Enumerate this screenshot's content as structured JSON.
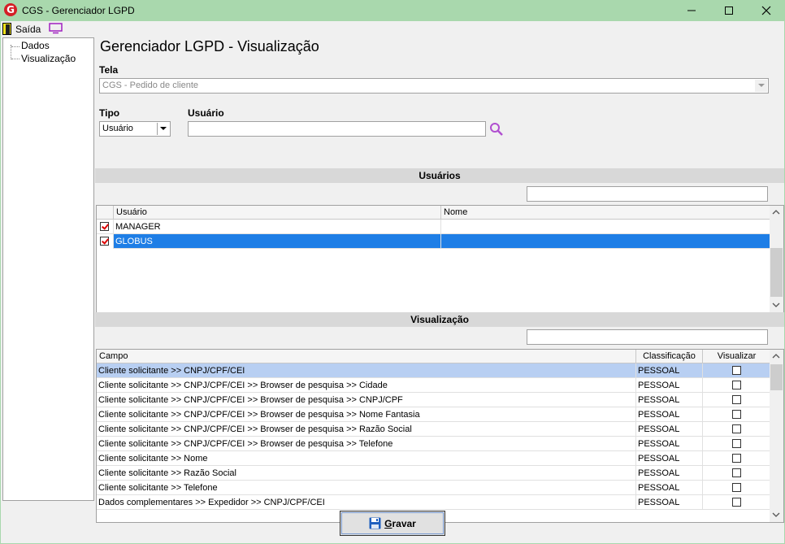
{
  "window": {
    "title": "CGS - Gerenciador LGPD",
    "logo_letter": "G"
  },
  "menu": {
    "saida_label": "Saída"
  },
  "tree": {
    "items": [
      "Dados",
      "Visualização"
    ]
  },
  "page": {
    "title": "Gerenciador LGPD - Visualização"
  },
  "form": {
    "tela_label": "Tela",
    "tela_value": "CGS - Pedido de cliente",
    "tipo_label": "Tipo",
    "tipo_value": "Usuário",
    "usuario_label": "Usuário",
    "usuario_value": ""
  },
  "usuarios": {
    "header": "Usuários",
    "filter_value": "",
    "columns": [
      "Usuário",
      "Nome"
    ],
    "rows": [
      {
        "checked": true,
        "usuario": "MANAGER",
        "nome": "",
        "selected": false
      },
      {
        "checked": true,
        "usuario": "GLOBUS",
        "nome": "",
        "selected": true
      }
    ]
  },
  "visualizacao": {
    "header": "Visualização",
    "filter_value": "",
    "columns": [
      "Campo",
      "Classificação",
      "Visualizar"
    ],
    "rows": [
      {
        "campo": "Cliente solicitante >> CNPJ/CPF/CEI",
        "classificacao": "PESSOAL",
        "visualizar": false
      },
      {
        "campo": "Cliente solicitante >> CNPJ/CPF/CEI >> Browser de pesquisa >> Cidade",
        "classificacao": "PESSOAL",
        "visualizar": false
      },
      {
        "campo": "Cliente solicitante >> CNPJ/CPF/CEI >> Browser de pesquisa >> CNPJ/CPF",
        "classificacao": "PESSOAL",
        "visualizar": false
      },
      {
        "campo": "Cliente solicitante >> CNPJ/CPF/CEI >> Browser de pesquisa >> Nome Fantasia",
        "classificacao": "PESSOAL",
        "visualizar": false
      },
      {
        "campo": "Cliente solicitante >> CNPJ/CPF/CEI >> Browser de pesquisa >> Razão Social",
        "classificacao": "PESSOAL",
        "visualizar": false
      },
      {
        "campo": "Cliente solicitante >> CNPJ/CPF/CEI >> Browser de pesquisa >> Telefone",
        "classificacao": "PESSOAL",
        "visualizar": false
      },
      {
        "campo": "Cliente solicitante >> Nome",
        "classificacao": "PESSOAL",
        "visualizar": false
      },
      {
        "campo": "Cliente solicitante >> Razão Social",
        "classificacao": "PESSOAL",
        "visualizar": false
      },
      {
        "campo": "Cliente solicitante >> Telefone",
        "classificacao": "PESSOAL",
        "visualizar": false
      },
      {
        "campo": "Dados complementares >> Expedidor >> CNPJ/CPF/CEI",
        "classificacao": "PESSOAL",
        "visualizar": false
      }
    ]
  },
  "actions": {
    "save_label": "Gravar",
    "save_accel": "G",
    "save_rest": "ravar"
  },
  "colors": {
    "window_frame": "#a9d8ad",
    "selection_blue": "#1e7ee6",
    "selection_light": "#b8cff2",
    "search_purple": "#b04fd0"
  }
}
